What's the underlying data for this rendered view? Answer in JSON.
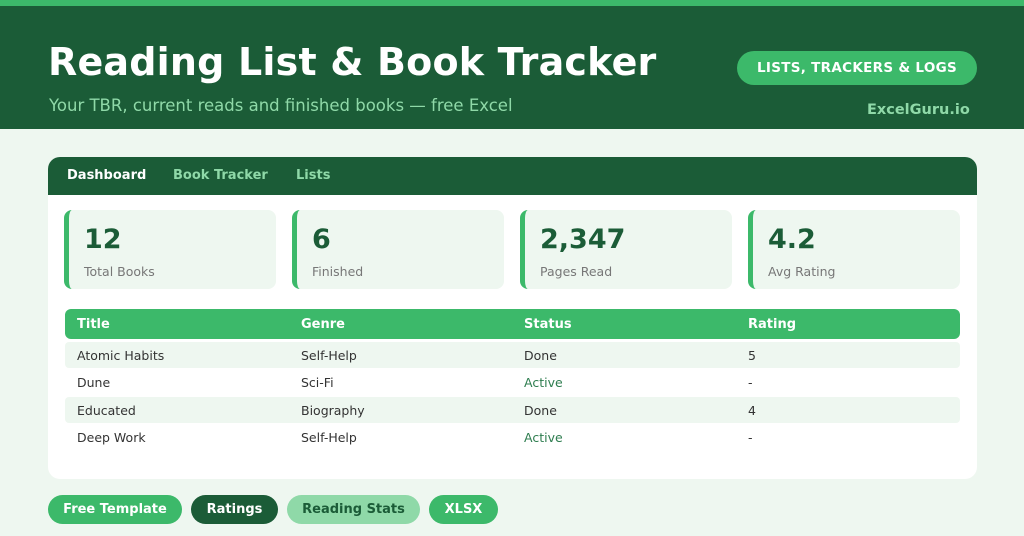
{
  "header": {
    "title": "Reading List & Book Tracker",
    "subtitle": "Your TBR, current reads and finished books — free Excel",
    "badge": "LISTS, TRACKERS & LOGS",
    "brand": "ExcelGuru.io"
  },
  "tabs": [
    {
      "label": "Dashboard",
      "active": true
    },
    {
      "label": "Book Tracker",
      "active": false
    },
    {
      "label": "Lists",
      "active": false
    }
  ],
  "stats": [
    {
      "value": "12",
      "label": "Total Books"
    },
    {
      "value": "6",
      "label": "Finished"
    },
    {
      "value": "2,347",
      "label": "Pages Read"
    },
    {
      "value": "4.2",
      "label": "Avg Rating"
    }
  ],
  "table": {
    "columns": [
      "Title",
      "Genre",
      "Status",
      "Rating"
    ],
    "rows": [
      [
        "Atomic Habits",
        "Self-Help",
        "Done",
        "5"
      ],
      [
        "Dune",
        "Sci-Fi",
        "Active",
        "-"
      ],
      [
        "Educated",
        "Biography",
        "Done",
        "4"
      ],
      [
        "Deep Work",
        "Self-Help",
        "Active",
        "-"
      ]
    ]
  },
  "tags": [
    "Free Template",
    "Ratings",
    "Reading Stats",
    "XLSX"
  ],
  "colors": {
    "dark_green": "#1b5c37",
    "accent_green": "#3cb96a",
    "light_green": "#8fd9a8",
    "background": "#eef7f0"
  }
}
